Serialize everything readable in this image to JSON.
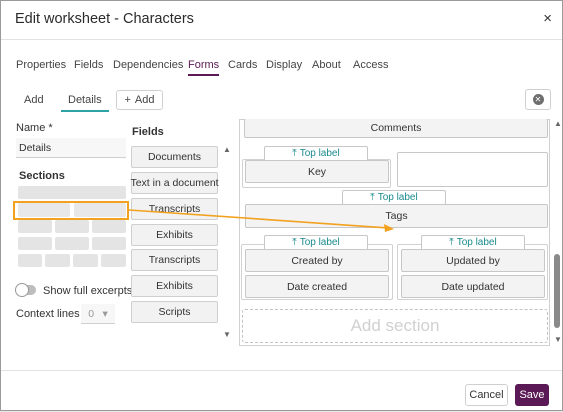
{
  "dialog": {
    "title": "Edit worksheet - Characters",
    "close_icon": "×"
  },
  "tabs": [
    "Properties",
    "Fields",
    "Dependencies",
    "Forms",
    "Cards",
    "Display",
    "About",
    "Access"
  ],
  "active_tab": "Forms",
  "subtabs": {
    "add": "Add",
    "details": "Details",
    "add_button": "Add",
    "add_button_icon": "+"
  },
  "left": {
    "name_label": "Name *",
    "name_value": "Details",
    "sections_label": "Sections",
    "show_full_excerpts": "Show full excerpts",
    "context_lines_label": "Context lines",
    "context_lines_value": "0",
    "context_chevron": "▾"
  },
  "fields": {
    "title": "Fields",
    "items": [
      "Documents",
      "Text in a document",
      "Transcripts",
      "Exhibits",
      "Transcripts",
      "Exhibits",
      "Scripts"
    ],
    "scroll_up": "▲",
    "scroll_down": "▼"
  },
  "layout": {
    "comments": "Comments",
    "top_label": "Top label",
    "top_label_icon": "⤒",
    "key": "Key",
    "tags": "Tags",
    "created_by": "Created by",
    "date_created": "Date created",
    "updated_by": "Updated by",
    "date_updated": "Date updated",
    "add_section": "Add section"
  },
  "footer": {
    "cancel": "Cancel",
    "save": "Save"
  },
  "colors": {
    "accent": "#5b1a55",
    "teal": "#1a8a8c",
    "highlight": "#f2a21f"
  }
}
